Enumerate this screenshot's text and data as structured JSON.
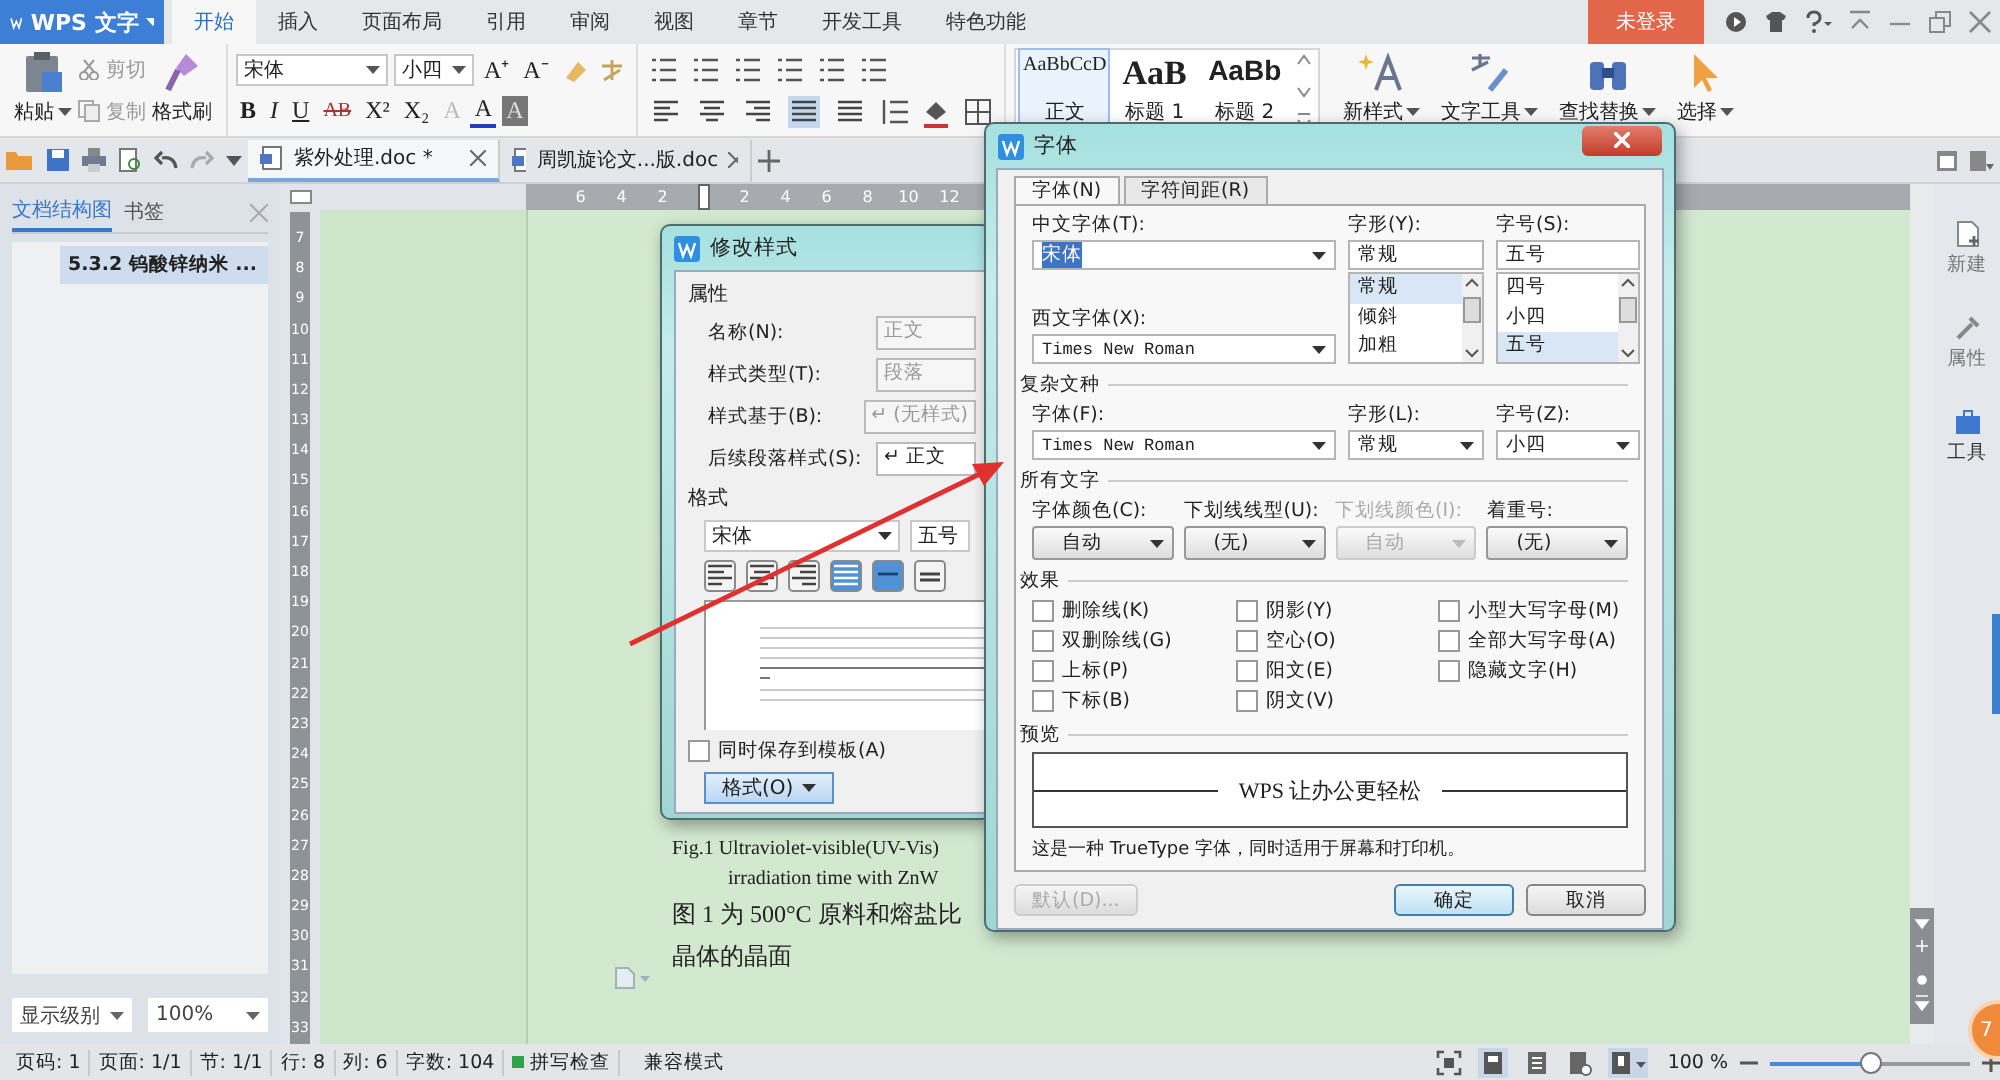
{
  "app_menu": {
    "label": "WPS 文字"
  },
  "ribbon_tabs": [
    {
      "label": "开始",
      "selected": true
    },
    {
      "label": "插入",
      "selected": false
    },
    {
      "label": "页面布局",
      "selected": false
    },
    {
      "label": "引用",
      "selected": false
    },
    {
      "label": "审阅",
      "selected": false
    },
    {
      "label": "视图",
      "selected": false
    },
    {
      "label": "章节",
      "selected": false
    },
    {
      "label": "开发工具",
      "selected": false
    },
    {
      "label": "特色功能",
      "selected": false
    }
  ],
  "login_button": "未登录",
  "ribbon": {
    "paste": "粘贴",
    "cut": "剪切",
    "copy": "复制",
    "format_painter": "格式刷",
    "font_name": "宋体",
    "font_size": "小四",
    "size_buttons": [
      "A⁺",
      "A⁻"
    ],
    "format_buttons": [
      {
        "glyph": "B",
        "kind": "bold"
      },
      {
        "glyph": "I",
        "kind": "italic"
      },
      {
        "glyph": "U",
        "kind": "underline"
      },
      {
        "glyph": "AB",
        "kind": "strike"
      },
      {
        "glyph": "X²",
        "kind": "sup"
      },
      {
        "glyph": "X₂",
        "kind": "sub"
      },
      {
        "glyph": "A",
        "kind": "effect"
      },
      {
        "glyph": "A",
        "kind": "color"
      },
      {
        "glyph": "A",
        "kind": "shade"
      }
    ],
    "alignments": [
      {
        "kind": "left",
        "selected": false
      },
      {
        "kind": "center",
        "selected": false
      },
      {
        "kind": "right",
        "selected": false
      },
      {
        "kind": "justify",
        "selected": true
      },
      {
        "kind": "distributed",
        "selected": false
      }
    ],
    "styles": [
      {
        "preview": "AaBbCcD",
        "label": "正文",
        "selected": true
      },
      {
        "preview": "AaB",
        "label": "标题 1",
        "selected": false
      },
      {
        "preview": "AaBb",
        "label": "标题 2",
        "selected": false
      }
    ],
    "tools": [
      {
        "label": "新样式",
        "kind": "new-style"
      },
      {
        "label": "文字工具",
        "kind": "text-tools"
      },
      {
        "label": "查找替换",
        "kind": "find"
      },
      {
        "label": "选择",
        "kind": "select"
      }
    ]
  },
  "doc_tabs": [
    {
      "label": "紫外处理.doc *",
      "selected": true
    },
    {
      "label": "周凯旋论文...版.doc",
      "selected": false
    }
  ],
  "nav_panel": {
    "tabs": [
      {
        "label": "文档结构图",
        "selected": true
      },
      {
        "label": "书签",
        "selected": false
      }
    ],
    "items": [
      {
        "label": "5.3.2 钨酸锌纳米 ...",
        "selected": true
      }
    ],
    "level_select": "显示级别",
    "zoom_select": "100%"
  },
  "ruler": {
    "horizontal": [
      "6",
      "4",
      "2",
      "2",
      "4",
      "6",
      "8",
      "10",
      "12"
    ],
    "vertical": [
      "7",
      "8",
      "9",
      "10",
      "11",
      "12",
      "13",
      "14",
      "15",
      "16",
      "17",
      "18",
      "19",
      "20",
      "21",
      "22",
      "23",
      "24",
      "25",
      "26",
      "27",
      "28",
      "29",
      "30",
      "31",
      "32",
      "33"
    ]
  },
  "document": {
    "lines": [
      {
        "text": "Fig.1 Ultraviolet-visible(UV-Vis)",
        "kind": "caption"
      },
      {
        "text": "irradiation time with ZnW",
        "kind": "caption-indent"
      },
      {
        "text": "图 1 为 500°C 原料和熔盐比",
        "kind": "body"
      },
      {
        "text": "晶体的晶面",
        "kind": "body"
      }
    ]
  },
  "side_pane": [
    {
      "label": "新建",
      "kind": "new"
    },
    {
      "label": "属性",
      "kind": "properties"
    },
    {
      "label": "工具",
      "kind": "tools"
    }
  ],
  "modify_style_dialog": {
    "title": "修改样式",
    "properties_heading": "属性",
    "fields": [
      {
        "label": "名称(N):",
        "value": "正文",
        "disabled": true
      },
      {
        "label": "样式类型(T):",
        "value": "段落",
        "disabled": true
      },
      {
        "label": "样式基于(B):",
        "value": "↵ (无样式)",
        "disabled": true
      },
      {
        "label": "后续段落样式(S):",
        "value": "↵ 正文",
        "disabled": false
      }
    ],
    "format_heading": "格式",
    "font_name": "宋体",
    "font_size": "五号",
    "alignments": [
      {
        "kind": "left",
        "selected": false
      },
      {
        "kind": "center",
        "selected": false
      },
      {
        "kind": "right",
        "selected": false
      },
      {
        "kind": "justify",
        "selected": true
      }
    ],
    "spacing": [
      {
        "kind": "single",
        "selected": true
      },
      {
        "kind": "double",
        "selected": false
      }
    ],
    "save_to_template": {
      "label": "同时保存到模板(A)",
      "checked": false
    },
    "format_button": "格式(O)"
  },
  "font_dialog": {
    "title": "字体",
    "tabs": [
      {
        "label": "字体(N)",
        "selected": true
      },
      {
        "label": "字符间距(R)",
        "selected": false
      }
    ],
    "chinese_font": {
      "label": "中文字体(T):",
      "value": "宋体",
      "text_selected": true
    },
    "style": {
      "label": "字形(Y):",
      "value": "常规",
      "options": [
        {
          "label": "常规",
          "selected": true
        },
        {
          "label": "倾斜",
          "selected": false
        },
        {
          "label": "加粗",
          "selected": false
        }
      ]
    },
    "size": {
      "label": "字号(S):",
      "value": "五号",
      "options": [
        {
          "label": "四号",
          "selected": false
        },
        {
          "label": "小四",
          "selected": false
        },
        {
          "label": "五号",
          "selected": true
        }
      ]
    },
    "western_font": {
      "label": "西文字体(X):",
      "value": "Times New Roman"
    },
    "complex_heading": "复杂文种",
    "complex_font": {
      "label": "字体(F):",
      "value": "Times New Roman"
    },
    "complex_style": {
      "label": "字形(L):",
      "value": "常规"
    },
    "complex_size": {
      "label": "字号(Z):",
      "value": "小四"
    },
    "all_text_heading": "所有文字",
    "all_text_fields": [
      {
        "label": "字体颜色(C):",
        "value": "自动",
        "disabled": false
      },
      {
        "label": "下划线线型(U):",
        "value": "(无)",
        "disabled": false
      },
      {
        "label": "下划线颜色(I):",
        "value": "自动",
        "disabled": true
      },
      {
        "label": "着重号:",
        "value": "(无)",
        "disabled": false
      }
    ],
    "effects_heading": "效果",
    "effect_columns": [
      [
        {
          "label": "删除线(K)",
          "checked": false
        },
        {
          "label": "双删除线(G)",
          "checked": false
        },
        {
          "label": "上标(P)",
          "checked": false
        },
        {
          "label": "下标(B)",
          "checked": false
        }
      ],
      [
        {
          "label": "阴影(Y)",
          "checked": false
        },
        {
          "label": "空心(O)",
          "checked": false
        },
        {
          "label": "阳文(E)",
          "checked": false
        },
        {
          "label": "阴文(V)",
          "checked": false
        }
      ],
      [
        {
          "label": "小型大写字母(M)",
          "checked": false
        },
        {
          "label": "全部大写字母(A)",
          "checked": false
        },
        {
          "label": "隐藏文字(H)",
          "checked": false
        }
      ]
    ],
    "preview_heading": "预览",
    "preview_text": "WPS 让办公更轻松",
    "note": "这是一种 TrueType 字体，同时适用于屏幕和打印机。",
    "buttons": [
      {
        "label": "默认(D)...",
        "kind": "default",
        "disabled": true
      },
      {
        "label": "确定",
        "kind": "ok",
        "disabled": false
      },
      {
        "label": "取消",
        "kind": "cancel",
        "disabled": false
      }
    ]
  },
  "status_bar": {
    "items": [
      "页码: 1",
      "页面: 1/1",
      "节: 1/1",
      "行: 8",
      "列: 6",
      "字数: 104"
    ],
    "spell_check": "拼写检查",
    "mode": "兼容模式",
    "zoom": "100 %",
    "zoom_slider": {
      "level": 0.5
    }
  },
  "floating_badge": "7",
  "annotation": {
    "kind": "arrow"
  }
}
